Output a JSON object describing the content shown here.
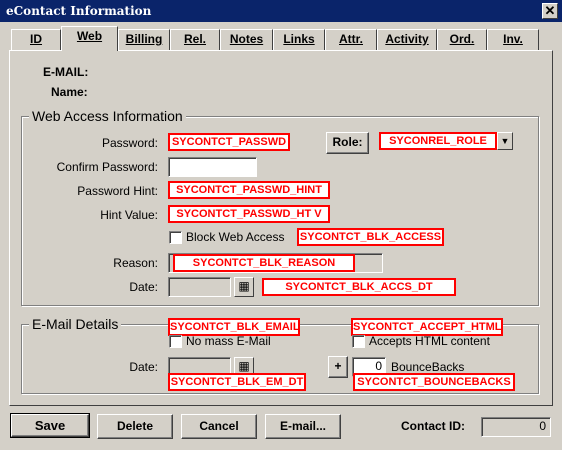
{
  "window": {
    "title": "eContact Information",
    "close_icon": "close-icon"
  },
  "tabs": [
    {
      "label": "ID"
    },
    {
      "label": "Web"
    },
    {
      "label": "Billing"
    },
    {
      "label": "Rel."
    },
    {
      "label": "Notes"
    },
    {
      "label": "Links"
    },
    {
      "label": "Attr."
    },
    {
      "label": "Activity"
    },
    {
      "label": "Ord."
    },
    {
      "label": "Inv."
    }
  ],
  "active_tab": "Web",
  "header": {
    "email_label": "E-MAIL:",
    "name_label": "Name:"
  },
  "web_access": {
    "group_title": "Web Access Information",
    "password_label": "Password:",
    "password_tag": "SYCONTCT_PASSWD",
    "role_button": "Role:",
    "role_tag": "SYCONREL_ROLE",
    "confirm_label": "Confirm Password:",
    "hint_label": "Password Hint:",
    "hint_tag": "SYCONTCT_PASSWD_HINT",
    "hint_value_label": "Hint Value:",
    "hint_value_tag": "SYCONTCT_PASSWD_HT V",
    "block_label": "Block Web Access",
    "block_tag": "SYCONTCT_BLK_ACCESS",
    "reason_label": "Reason:",
    "reason_tag": "SYCONTCT_BLK_REASON",
    "date_label": "Date:",
    "date_tag": "SYCONTCT_BLK_ACCS_DT"
  },
  "email_details": {
    "group_title": "E-Mail Details",
    "email_tag": "SYCONTCT_BLK_EMAIL",
    "accept_tag": "SYCONTCT_ACCEPT_HTML",
    "no_mass_label": "No mass E-Mail",
    "accept_label": "Accepts HTML content",
    "date_label": "Date:",
    "date_tag": "SYCONTCT_BLK_EM_DT",
    "plus_button": "+",
    "bounce_value": "0",
    "bounce_label": "BounceBacks",
    "bounce_tag": "SYCONTCT_BOUNCEBACKS"
  },
  "footer": {
    "save": "Save",
    "delete": "Delete",
    "cancel": "Cancel",
    "email": "E-mail...",
    "contact_id_label": "Contact ID:",
    "contact_id_value": "0"
  },
  "colors": {
    "titlebar": "#0a246a",
    "face": "#d4d0c8",
    "tag_red": "#ff0000"
  }
}
